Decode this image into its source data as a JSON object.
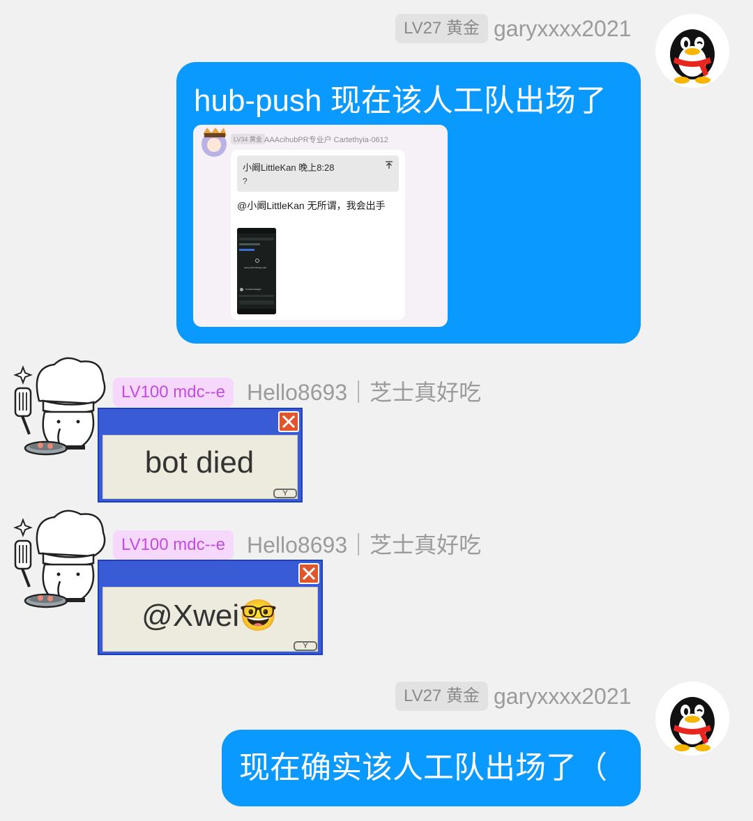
{
  "messages": [
    {
      "side": "right",
      "badge": "LV27 黄金",
      "nickname": "garyxxxx2021",
      "text": "hub-push 现在该人工队出场了",
      "embed": {
        "badge": "LV34 黄金",
        "nickname": "AAAcihubPR专业户 Cartethyia-0612",
        "quote_title": "小阚LittleKan 晚上8:28",
        "quote_body": "?",
        "message": "@小阚LittleKan 无所谓，我会出手",
        "phone_title": "Using cihub Please wait",
        "phone_status": "Commit changes"
      }
    },
    {
      "side": "left",
      "badge": "LV100 mdc--e",
      "nickname": "Hello8693｜芝士真好吃",
      "dialog_text": "bot died",
      "dialog_button": "Y"
    },
    {
      "side": "left",
      "badge": "LV100 mdc--e",
      "nickname": "Hello8693｜芝士真好吃",
      "dialog_text": "@Xwei🤓",
      "dialog_button": "Y"
    },
    {
      "side": "right",
      "badge": "LV27 黄金",
      "nickname": "garyxxxx2021",
      "text": "现在确实该人工队出场了（"
    }
  ],
  "colors": {
    "background": "#f1f1f1",
    "bubble": "#0a99ff",
    "badge_grey": "#e2e2e2",
    "badge_purple": "#f5d8fb",
    "dialog_title": "#3a5bd6",
    "dialog_close": "#e0552c"
  }
}
